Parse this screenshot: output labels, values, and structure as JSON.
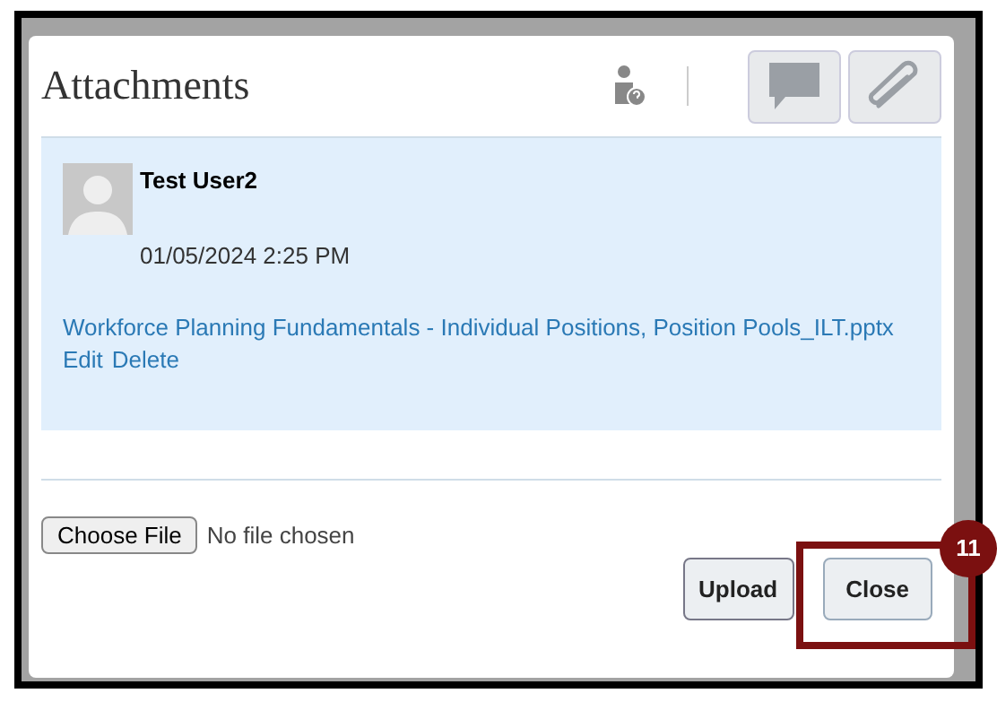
{
  "dialog": {
    "title": "Attachments",
    "attachments": [
      {
        "user": "Test User2",
        "timestamp": "01/05/2024 2:25 PM",
        "file_name": "Workforce Planning Fundamentals - Individual Positions, Position Pools_ILT.pptx",
        "actions": [
          "Edit",
          "Delete"
        ]
      }
    ],
    "file_input": {
      "button": "Choose File",
      "status": "No file chosen"
    },
    "buttons": [
      "Upload",
      "Close"
    ]
  },
  "callout": {
    "number": "11"
  }
}
